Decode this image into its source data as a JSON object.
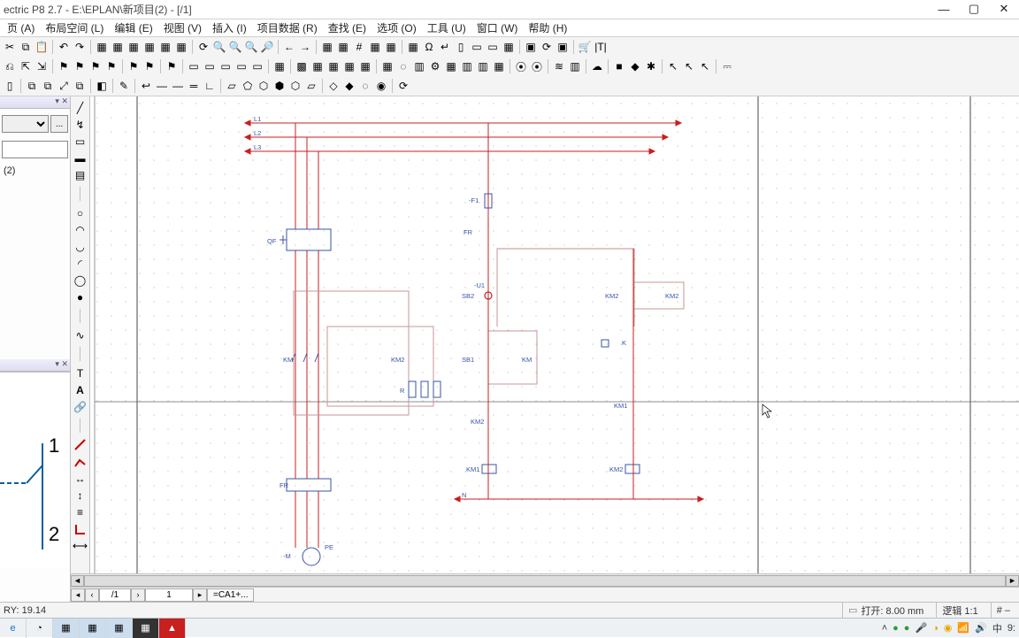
{
  "title": "ectric P8 2.7 - E:\\EPLAN\\新项目(2) - [/1]",
  "menu": {
    "page": "页 (A)",
    "layout": "布局空间 (L)",
    "edit": "编辑 (E)",
    "view": "视图 (V)",
    "insert": "插入 (I)",
    "projectdata": "项目数据 (R)",
    "find": "查找 (E)",
    "options": "选项 (O)",
    "tools": "工具 (U)",
    "window": "窗口 (W)",
    "help": "帮助 (H)"
  },
  "panel": {
    "close_glyph": "▾ ✕",
    "tree_item": "(2)",
    "dots": "..."
  },
  "preview": {
    "num1": "1",
    "num2": "2"
  },
  "tabs": {
    "page_label": "/1",
    "page_num": "1",
    "loc": "=CA1+..."
  },
  "status": {
    "left": "RY: 19.14",
    "open": "打开: 8.00 mm",
    "logic": "逻辑 1:1",
    "hash": "# –"
  },
  "tray": {
    "ime": "中",
    "time": "9:"
  },
  "schematic": {
    "L1": "L1",
    "L2": "L2",
    "L3": "L3",
    "QF": "QF",
    "KM": "KM",
    "KM2": "KM2",
    "SB1": "SB1",
    "SB2": "SB2",
    "FR": "FR",
    "R": "R",
    "F1": "-F1",
    "U1": "-U1",
    "KM_r": "KM",
    "KM1_b": "KM1",
    "KM2_r": "KM2",
    "KM2_b": "KM2",
    "N": "N",
    "M": "-M",
    "PE": "PE"
  }
}
